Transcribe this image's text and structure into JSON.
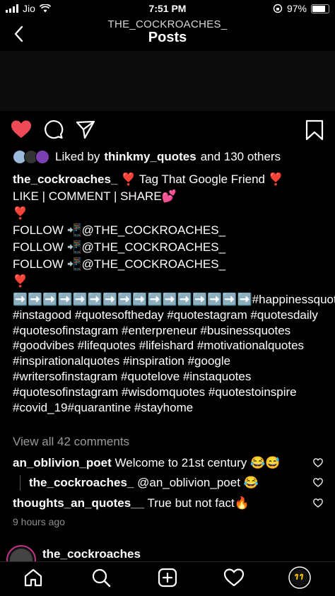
{
  "status_bar": {
    "carrier": "Jio",
    "time": "7:51 PM",
    "battery": "97%"
  },
  "header": {
    "subtitle": "THE_COCKROACHES_",
    "title": "Posts"
  },
  "post": {
    "liked_by_prefix": "Liked by",
    "liked_by_user": "thinkmy_quotes",
    "liked_by_suffix": "and 130 others",
    "caption_user": "the_cockroaches_",
    "caption_lines": [
      "❣️ Tag That Google Friend ❣️",
      "LIKE | COMMENT | SHARE💕",
      "❣️",
      "FOLLOW 📲@THE_COCKROACHES_",
      "FOLLOW 📲@THE_COCKROACHES_",
      "FOLLOW 📲@THE_COCKROACHES_",
      "❣️"
    ],
    "hashtags": "➡️➡️➡️➡️➡️➡️➡️➡️➡️➡️➡️➡️➡️➡️➡️➡️#happinessquotes #instagood #quotesoftheday #quotestagram #quotesdaily #quotesofinstagram #enterpreneur #businessquotes #goodvibes #lifequotes #lifeishard #motivationalquotes #inspirationalquotes #inspiration #google #writersofinstagram #quotelove #instaquotes #quotesofinstagram #wisdomquotes #quotestoinspire #covid_19#quarantine #stayhome",
    "view_all_comments": "View all 42 comments",
    "comments": [
      {
        "user": "an_oblivion_poet",
        "text": "Welcome to 21st century 😂😅"
      },
      {
        "user": "the_cockroaches_",
        "text": "@an_oblivion_poet 😂"
      },
      {
        "user": "thoughts_an_quotes__",
        "text": "True but not fact🔥"
      }
    ],
    "time_ago": "9 hours ago"
  },
  "next_post": {
    "user": "the_cockroaches"
  },
  "colors": {
    "background": "#000000",
    "like_red": "#ed4956",
    "muted": "#8e8e8e"
  },
  "icons": {
    "back": "chevron-left-icon",
    "like": "heart-filled-icon",
    "comment": "comment-icon",
    "share": "paper-plane-icon",
    "save": "bookmark-icon",
    "home": "home-icon",
    "search": "search-icon",
    "create": "plus-square-icon",
    "activity": "heart-icon",
    "profile": "avatar-icon"
  }
}
